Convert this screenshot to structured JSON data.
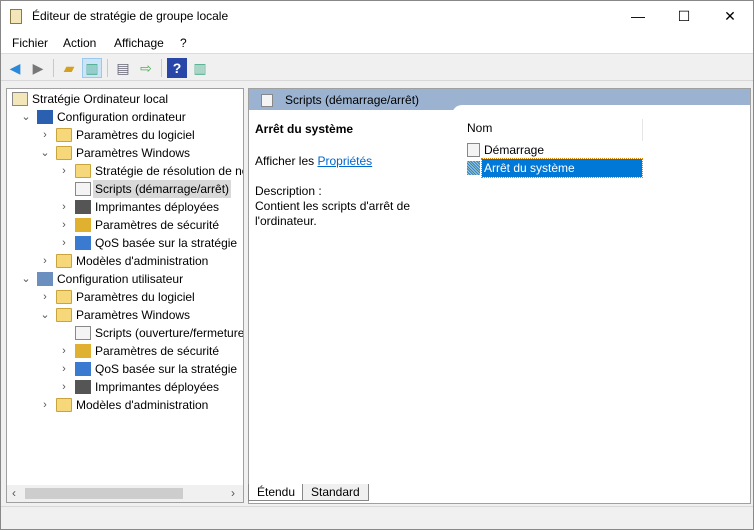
{
  "window": {
    "title": "Éditeur de stratégie de groupe locale",
    "minimize": "—",
    "maximize": "☐",
    "close": "✕"
  },
  "menu": [
    "Fichier",
    "Action",
    "Affichage",
    "?"
  ],
  "toolbar": [
    "back-icon",
    "forward-icon",
    "up-folder-icon",
    "show-hide-tree-icon",
    "properties-icon",
    "export-list-icon",
    "help-icon",
    "show-action-pane-icon"
  ],
  "tree": [
    {
      "label": "Stratégie Ordinateur local",
      "level": 0,
      "icon": "policy",
      "exp": ""
    },
    {
      "label": "Configuration ordinateur",
      "level": 1,
      "icon": "computer",
      "exp": "open"
    },
    {
      "label": "Paramètres du logiciel",
      "level": 2,
      "icon": "folder",
      "exp": "closed"
    },
    {
      "label": "Paramètres Windows",
      "level": 2,
      "icon": "folder",
      "exp": "open"
    },
    {
      "label": "Stratégie de résolution de noms",
      "level": 3,
      "icon": "folder",
      "exp": "closed"
    },
    {
      "label": "Scripts (démarrage/arrêt)",
      "level": 3,
      "icon": "doc",
      "exp": "",
      "sel": true
    },
    {
      "label": "Imprimantes déployées",
      "level": 3,
      "icon": "printer",
      "exp": "closed"
    },
    {
      "label": "Paramètres de sécurité",
      "level": 3,
      "icon": "security",
      "exp": "closed"
    },
    {
      "label": "QoS basée sur la stratégie",
      "level": 3,
      "icon": "chart",
      "exp": "closed"
    },
    {
      "label": "Modèles d'administration",
      "level": 2,
      "icon": "folder",
      "exp": "closed"
    },
    {
      "label": "Configuration utilisateur",
      "level": 1,
      "icon": "user",
      "exp": "open"
    },
    {
      "label": "Paramètres du logiciel",
      "level": 2,
      "icon": "folder",
      "exp": "closed"
    },
    {
      "label": "Paramètres Windows",
      "level": 2,
      "icon": "folder",
      "exp": "open"
    },
    {
      "label": "Scripts (ouverture/fermeture de session)",
      "level": 3,
      "icon": "doc",
      "exp": ""
    },
    {
      "label": "Paramètres de sécurité",
      "level": 3,
      "icon": "security",
      "exp": "closed"
    },
    {
      "label": "QoS basée sur la stratégie",
      "level": 3,
      "icon": "chart",
      "exp": "closed"
    },
    {
      "label": "Imprimantes déployées",
      "level": 3,
      "icon": "printer",
      "exp": "closed"
    },
    {
      "label": "Modèles d'administration",
      "level": 2,
      "icon": "folder",
      "exp": "closed"
    }
  ],
  "right": {
    "header": "Scripts (démarrage/arrêt)",
    "heading": "Arrêt du système",
    "show_prefix": "Afficher les ",
    "properties_link": "Propriétés",
    "desc_label": "Description :",
    "desc_text": "Contient les scripts d'arrêt de l'ordinateur.",
    "column": "Nom",
    "items": [
      {
        "label": "Démarrage"
      },
      {
        "label": "Arrêt du système",
        "selected": true
      }
    ]
  },
  "tabs": [
    "Étendu",
    "Standard"
  ]
}
